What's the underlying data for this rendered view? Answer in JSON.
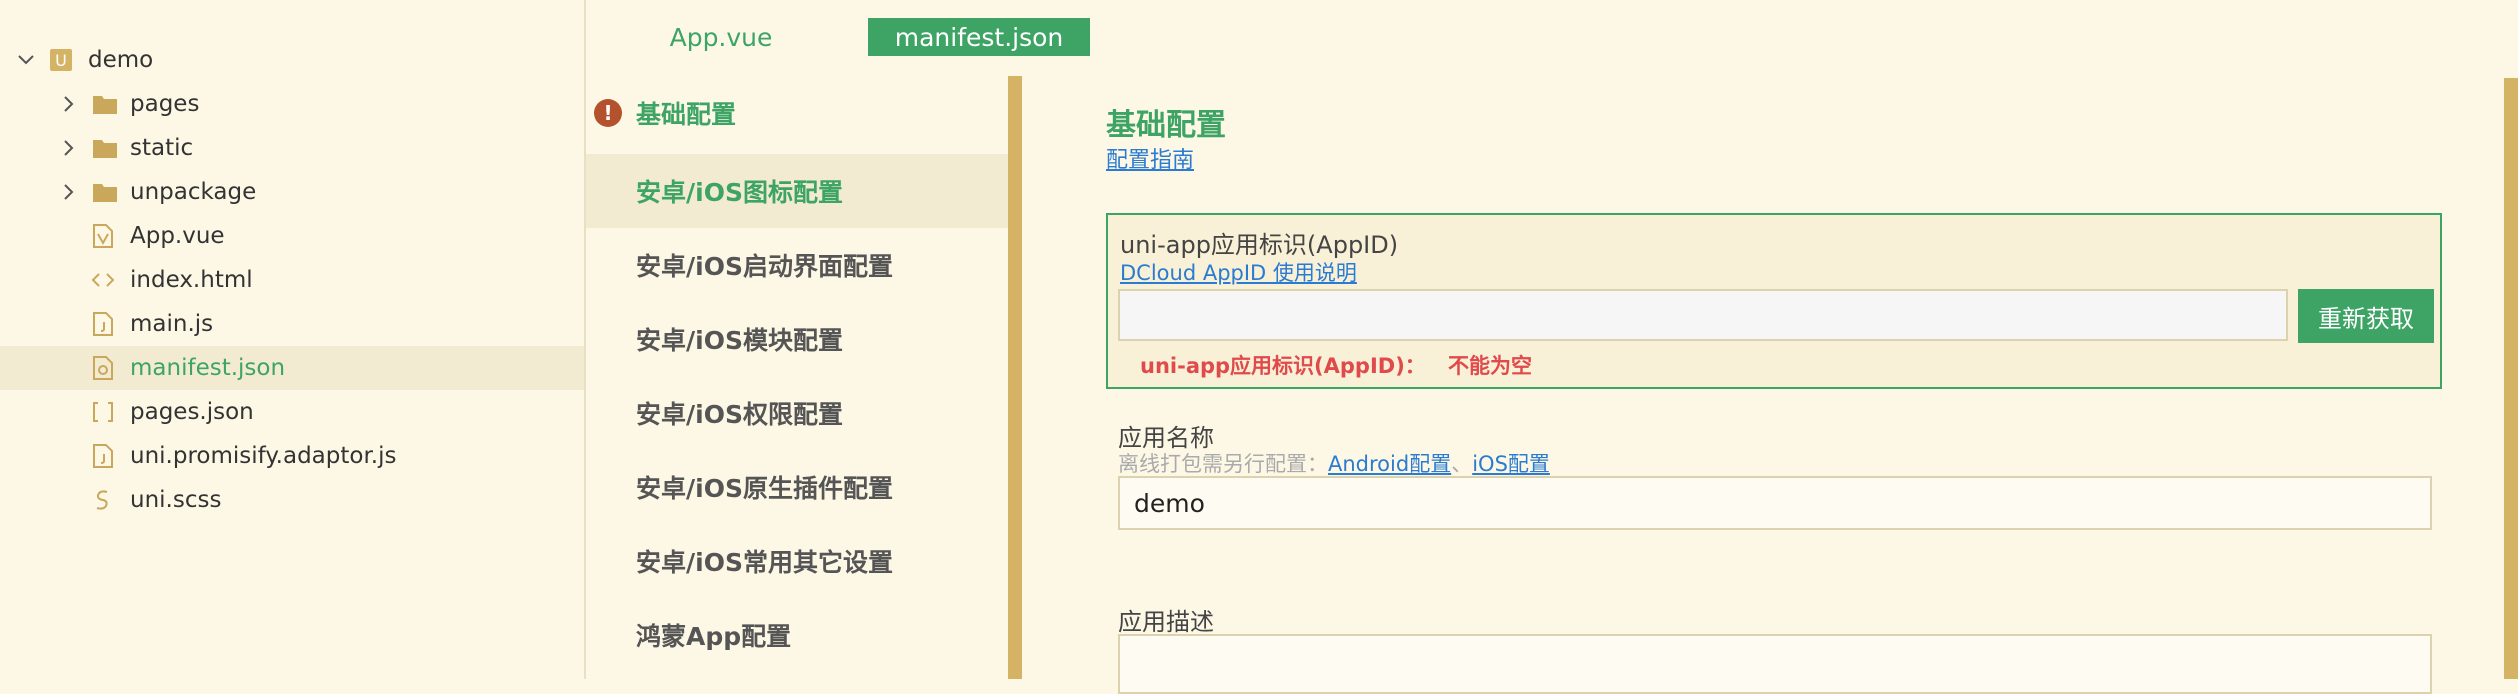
{
  "explorer": {
    "project": "demo",
    "items": [
      {
        "label": "pages",
        "icon": "folder-icon"
      },
      {
        "label": "static",
        "icon": "folder-icon"
      },
      {
        "label": "unpackage",
        "icon": "folder-icon"
      },
      {
        "label": "App.vue",
        "icon": "vue-file-icon"
      },
      {
        "label": "index.html",
        "icon": "html-file-icon"
      },
      {
        "label": "main.js",
        "icon": "js-file-icon"
      },
      {
        "label": "manifest.json",
        "icon": "manifest-file-icon"
      },
      {
        "label": "pages.json",
        "icon": "json-file-icon"
      },
      {
        "label": "uni.promisify.adaptor.js",
        "icon": "js-file-icon"
      },
      {
        "label": "uni.scss",
        "icon": "scss-file-icon"
      }
    ]
  },
  "tabs": [
    {
      "label": "App.vue"
    },
    {
      "label": "manifest.json"
    }
  ],
  "nav": [
    {
      "label": "基础配置"
    },
    {
      "label": "安卓/iOS图标配置"
    },
    {
      "label": "安卓/iOS启动界面配置"
    },
    {
      "label": "安卓/iOS模块配置"
    },
    {
      "label": "安卓/iOS权限配置"
    },
    {
      "label": "安卓/iOS原生插件配置"
    },
    {
      "label": "安卓/iOS常用其它设置"
    },
    {
      "label": "鸿蒙App配置"
    }
  ],
  "content": {
    "title": "基础配置",
    "guide_link": "配置指南",
    "appid": {
      "label": "uni-app应用标识(AppID)",
      "help_link": "DCloud AppID 使用说明",
      "value": "",
      "button": "重新获取",
      "error_label": "uni-app应用标识(AppID)：",
      "error_msg": "不能为空"
    },
    "app_name": {
      "label": "应用名称",
      "hint_prefix": "离线打包需另行配置：",
      "android_link": "Android配置",
      "separator": "、",
      "ios_link": "iOS配置",
      "value": "demo"
    },
    "app_desc": {
      "label": "应用描述",
      "value": ""
    }
  },
  "colors": {
    "accent": "#3ea465",
    "background": "#fdf8e6",
    "error": "#e04a4a",
    "link": "#2a7bd1",
    "warning": "#b5522e"
  }
}
